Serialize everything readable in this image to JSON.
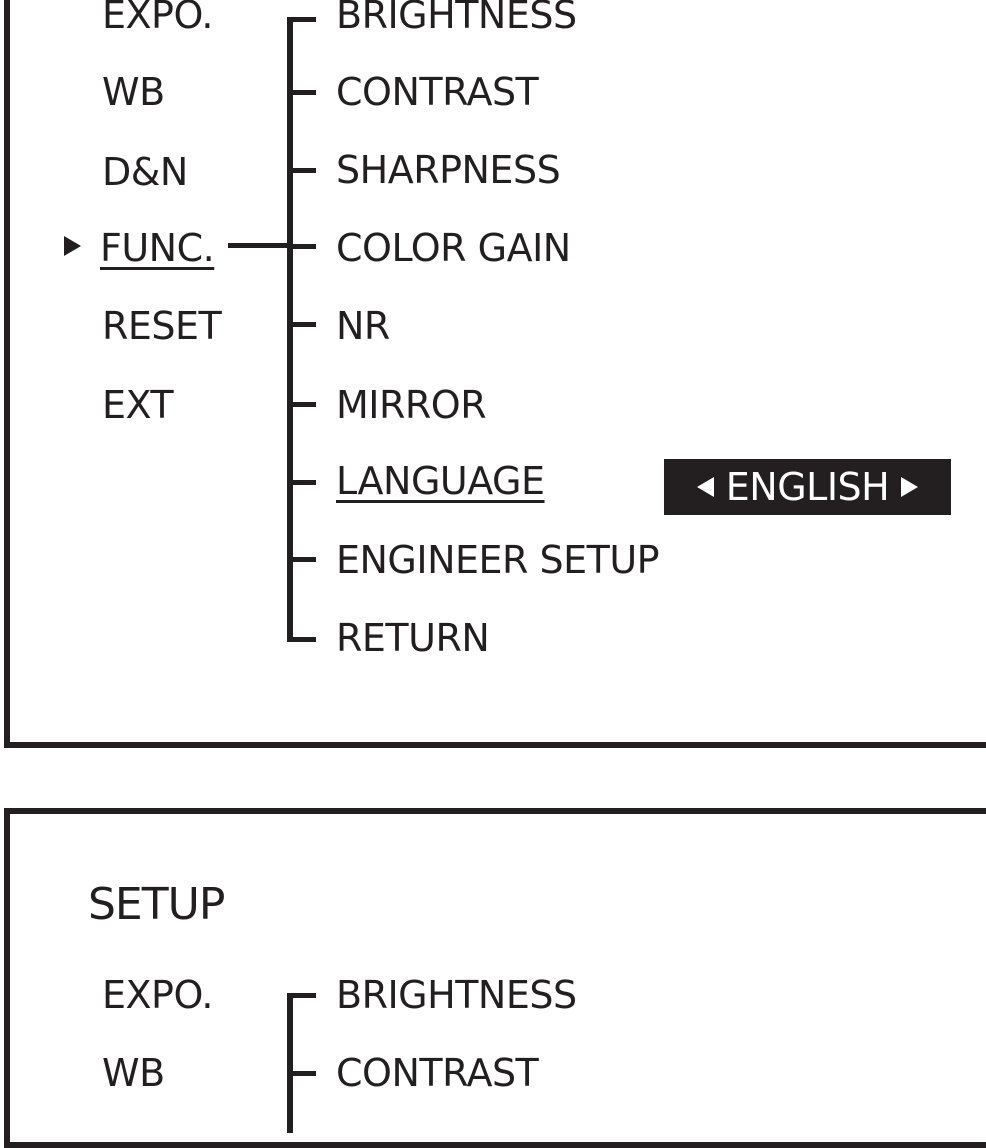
{
  "panel_top": {
    "main_menu": [
      "EXPO.",
      "WB",
      "D&N",
      "FUNC.",
      "RESET",
      "EXT"
    ],
    "selected_main": "FUNC.",
    "submenu": [
      "BRIGHTNESS",
      "CONTRAST",
      "SHARPNESS",
      "COLOR GAIN",
      "NR",
      "MIRROR",
      "LANGUAGE",
      "ENGINEER SETUP",
      "RETURN"
    ],
    "selected_sub": "LANGUAGE",
    "language_value": "ENGLISH",
    "icons": {
      "selection_pointer": "triangle-right-icon",
      "value_prev": "triangle-left-icon",
      "value_next": "triangle-right-icon"
    }
  },
  "panel_bottom": {
    "title": "SETUP",
    "main_menu": [
      "EXPO.",
      "WB"
    ],
    "submenu": [
      "BRIGHTNESS",
      "CONTRAST"
    ]
  },
  "colors": {
    "ink": "#231f20",
    "background": "#ffffff",
    "highlight_text": "#ffffff"
  }
}
